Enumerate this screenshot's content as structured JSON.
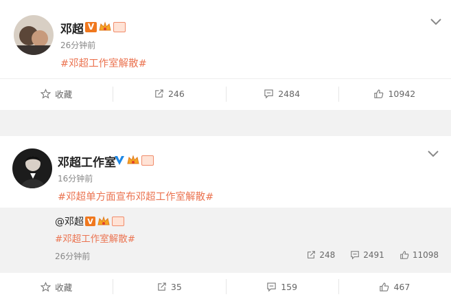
{
  "posts": [
    {
      "author": "邓超",
      "time": "26分钟前",
      "hashtag": "#邓超工作室解散#",
      "actions": {
        "favorite": "收藏",
        "repost": "246",
        "comment": "2484",
        "like": "10942"
      }
    },
    {
      "author": "邓超工作室",
      "time": "16分钟前",
      "hashtag": "#邓超单方面宣布邓超工作室解散#",
      "repost": {
        "author": "@邓超",
        "hashtag": "#邓超工作室解散#",
        "time": "26分钟前",
        "stats": {
          "repost": "248",
          "comment": "2491",
          "like": "11098"
        }
      },
      "actions": {
        "favorite": "收藏",
        "repost": "35",
        "comment": "159",
        "like": "467"
      }
    }
  ],
  "colors": {
    "accent": "#eb7350",
    "verified_orange": "#f0781e",
    "verified_blue": "#1e88e5"
  }
}
